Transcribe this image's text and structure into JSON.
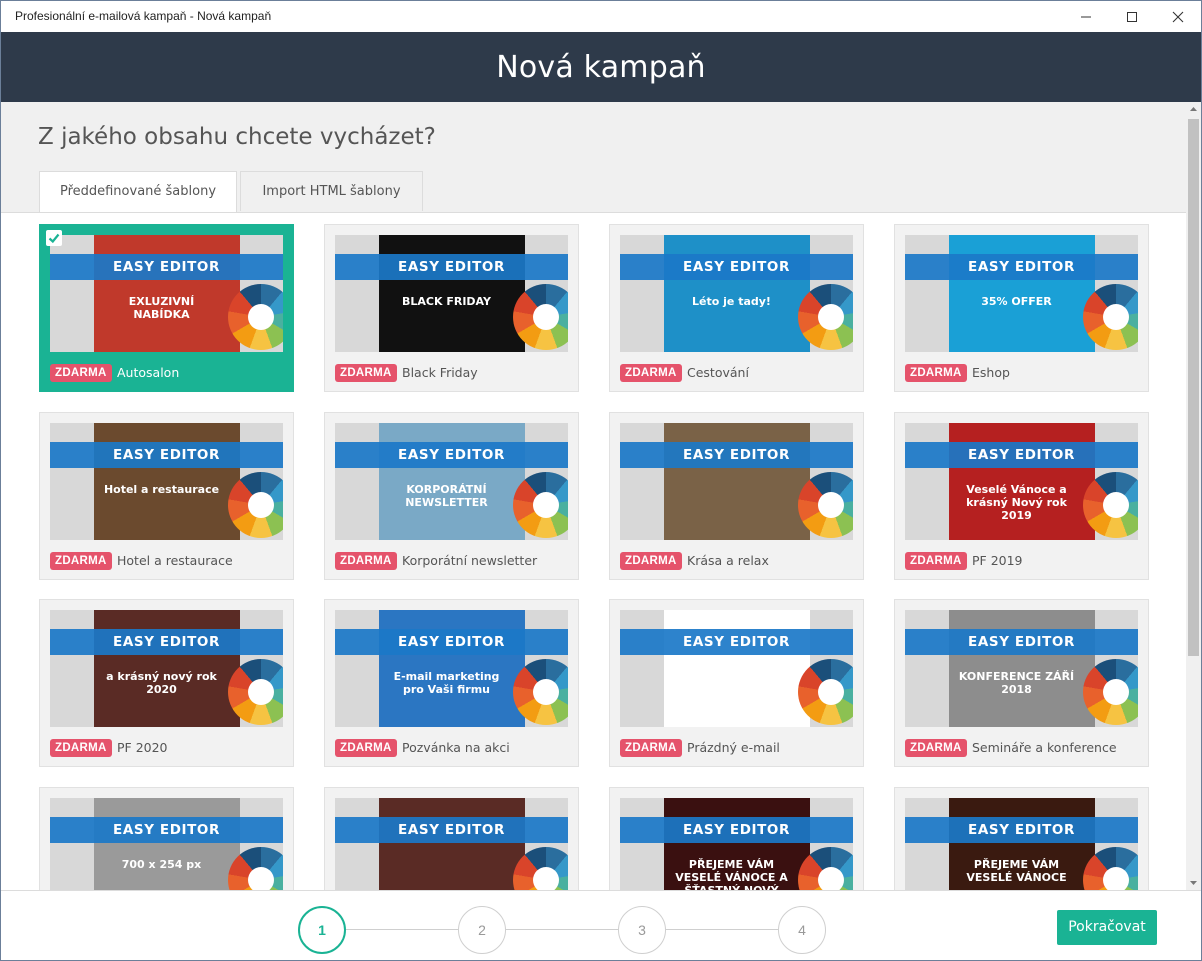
{
  "window": {
    "title": "Profesionální e-mailová kampaň - Nová kampaň"
  },
  "header": {
    "title": "Nová kampaň"
  },
  "question": "Z jakého obsahu chcete vycházet?",
  "tabs": [
    {
      "label": "Předdefinované šablony",
      "active": true
    },
    {
      "label": "Import HTML šablony",
      "active": false
    }
  ],
  "editor_label": "EASY EDITOR",
  "badge_label": "ZDARMA",
  "templates": [
    {
      "name": "Autosalon",
      "selected": true,
      "thumb_text": "EXLUZIVNÍ NABÍDKA",
      "theme": "#c0392b"
    },
    {
      "name": "Black Friday",
      "selected": false,
      "thumb_text": "BLACK FRIDAY",
      "theme": "#111111"
    },
    {
      "name": "Cestování",
      "selected": false,
      "thumb_text": "Léto je tady!",
      "theme": "#1e90c8"
    },
    {
      "name": "Eshop",
      "selected": false,
      "thumb_text": "35% OFFER",
      "theme": "#1aa0d6"
    },
    {
      "name": "Hotel a restaurace",
      "selected": false,
      "thumb_text": "Hotel a restaurace",
      "theme": "#6b4a2e"
    },
    {
      "name": "Korporátní newsletter",
      "selected": false,
      "thumb_text": "KORPORÁTNÍ NEWSLETTER",
      "theme": "#7aa9c6"
    },
    {
      "name": "Krása a relax",
      "selected": false,
      "thumb_text": "",
      "theme": "#7a6247"
    },
    {
      "name": "PF 2019",
      "selected": false,
      "thumb_text": "Veselé Vánoce a krásný Nový rok 2019",
      "theme": "#b52020"
    },
    {
      "name": "PF 2020",
      "selected": false,
      "thumb_text": "a krásný nový rok 2020",
      "theme": "#5a2b25"
    },
    {
      "name": "Pozvánka na akci",
      "selected": false,
      "thumb_text": "E-mail marketing pro Vaši firmu",
      "theme": "#2b76c2"
    },
    {
      "name": "Prázdný e-mail",
      "selected": false,
      "thumb_text": "",
      "theme": "#ffffff"
    },
    {
      "name": "Semináře a konference",
      "selected": false,
      "thumb_text": "KONFERENCE ZÁŘÍ 2018",
      "theme": "#8d8d8d"
    },
    {
      "name": "",
      "selected": false,
      "thumb_text": "700 x 254 px",
      "theme": "#9a9a9a"
    },
    {
      "name": "",
      "selected": false,
      "thumb_text": "",
      "theme": "#5a2b25"
    },
    {
      "name": "",
      "selected": false,
      "thumb_text": "PŘEJEME VÁM VESELÉ VÁNOCE A ŠŤASTNÝ NOVÝ ROK",
      "theme": "#3a1010"
    },
    {
      "name": "",
      "selected": false,
      "thumb_text": "PŘEJEME VÁM VESELÉ VÁNOCE",
      "theme": "#3a1a10"
    }
  ],
  "steps": [
    "1",
    "2",
    "3",
    "4"
  ],
  "continue_label": "Pokračovat",
  "colors": {
    "accent": "#1ab394",
    "header_bg": "#2e3a4a",
    "badge": "#e5536b",
    "banner": "#1b78c8"
  }
}
